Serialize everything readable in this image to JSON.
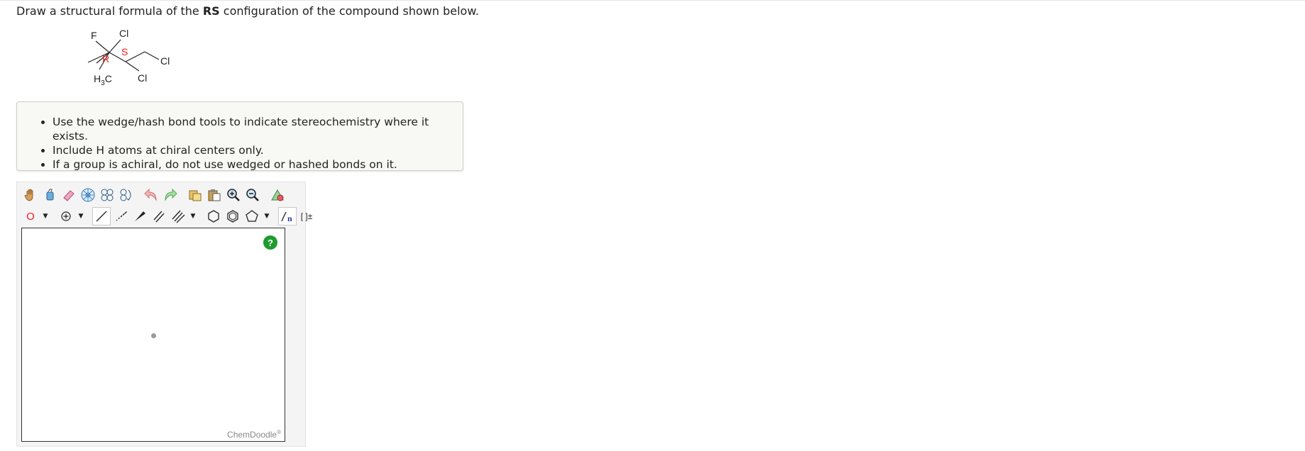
{
  "question": {
    "prefix": "Draw a structural formula of the ",
    "bold": "RS",
    "suffix": " configuration of the compound shown below."
  },
  "molecule": {
    "atom_f": "F",
    "atom_cl_top": "Cl",
    "atom_cl_right": "Cl",
    "atom_cl_bottom": "Cl",
    "label_r": "R",
    "label_s": "S",
    "methyl_h": "H",
    "methyl_sub": "3",
    "methyl_c": "C"
  },
  "instructions": [
    "Use the wedge/hash bond tools to indicate stereochemistry where it exists.",
    "Include H atoms at chiral centers only.",
    "If a group is achiral, do not use wedged or hashed bonds on it."
  ],
  "editor": {
    "element_label": "O",
    "help_label": "?",
    "brand": "ChemDoodle",
    "brand_mark": "®",
    "sgroup_n": "n",
    "bracket_label": "[ ]±"
  },
  "colors": {
    "stereo_label": "#e0211d",
    "help_green": "#1e9c2e",
    "element_red": "#e0211d"
  }
}
